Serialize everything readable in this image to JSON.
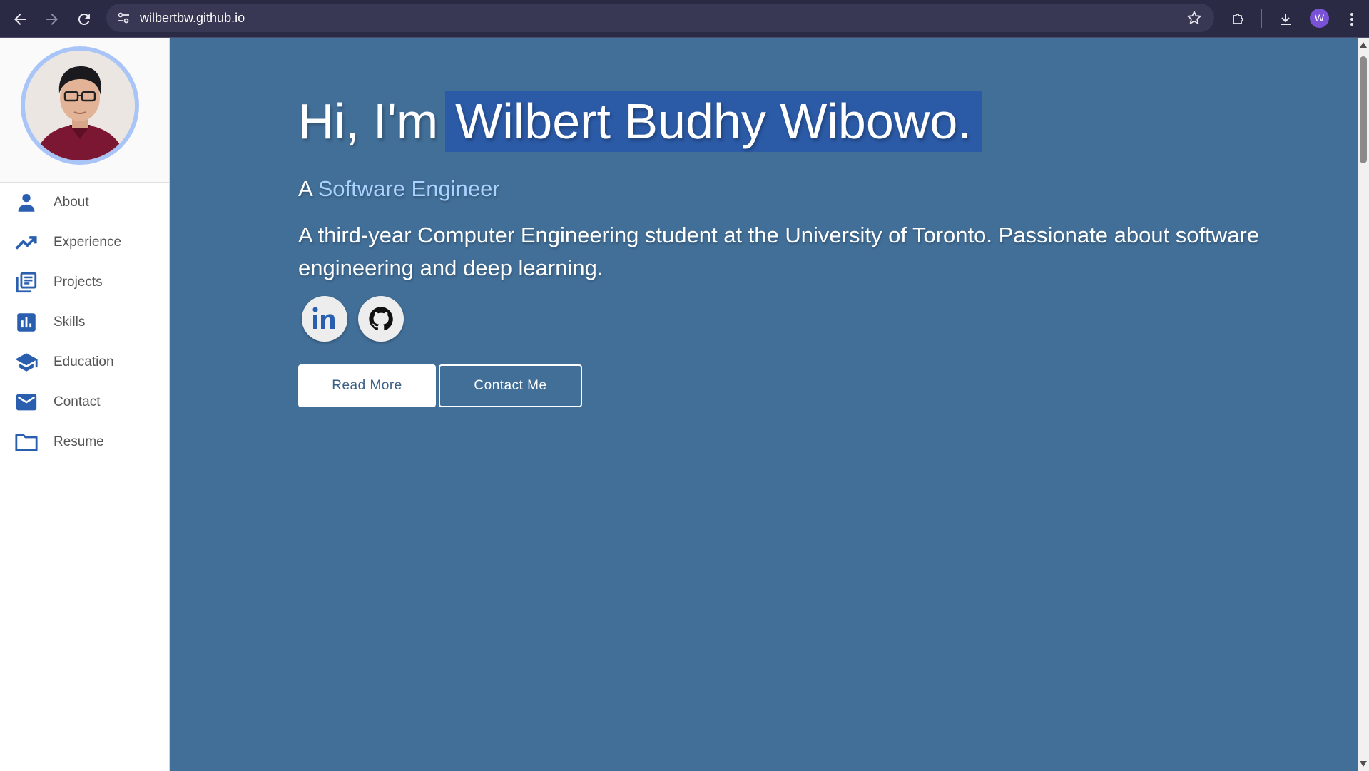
{
  "browser": {
    "url": "wilbertbw.github.io",
    "profile_initial": "W"
  },
  "sidebar": {
    "items": [
      {
        "label": "About",
        "icon": "person-icon"
      },
      {
        "label": "Experience",
        "icon": "trending-up-icon"
      },
      {
        "label": "Projects",
        "icon": "library-books-icon"
      },
      {
        "label": "Skills",
        "icon": "bar-chart-icon"
      },
      {
        "label": "Education",
        "icon": "graduation-cap-icon"
      },
      {
        "label": "Contact",
        "icon": "mail-icon"
      },
      {
        "label": "Resume",
        "icon": "folder-icon"
      }
    ]
  },
  "hero": {
    "greeting": "Hi, I'm",
    "name": "Wilbert Budhy Wibowo.",
    "subtitle_prefix": "A",
    "role": "Software Engineer",
    "description": "A third-year Computer Engineering student at the University of Toronto. Passionate about software engineering and deep learning.",
    "read_more_label": "Read More",
    "contact_label": "Contact Me"
  },
  "colors": {
    "main_background": "#426f98",
    "accent": "#2a5fb0",
    "name_highlight": "#2b5aa6",
    "role_text": "#a9d2ff",
    "chrome_background": "#2a2a44"
  }
}
